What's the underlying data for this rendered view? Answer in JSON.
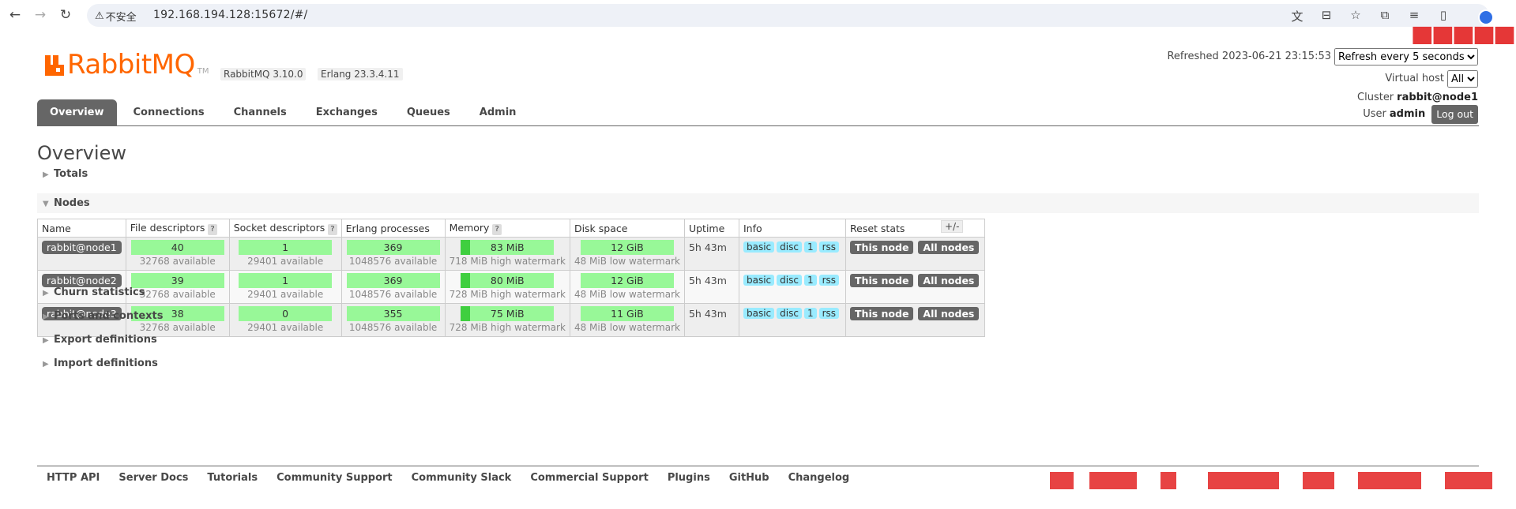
{
  "browser": {
    "security_label": "不安全",
    "url": "192.168.194.128:15672/#/"
  },
  "header": {
    "logo_text": "RabbitMQ",
    "logo_tm": "TM",
    "rabbitmq_version": "RabbitMQ 3.10.0",
    "erlang_version": "Erlang 23.3.4.11",
    "refreshed_label": "Refreshed 2023-06-21 23:15:53",
    "refresh_option": "Refresh every 5 seconds",
    "virtual_host_label": "Virtual host",
    "virtual_host_value": "All",
    "cluster_label": "Cluster",
    "cluster_value": "rabbit@node1",
    "user_label": "User",
    "user_value": "admin",
    "logout_label": "Log out"
  },
  "tabs": [
    {
      "label": "Overview"
    },
    {
      "label": "Connections"
    },
    {
      "label": "Channels"
    },
    {
      "label": "Exchanges"
    },
    {
      "label": "Queues"
    },
    {
      "label": "Admin"
    }
  ],
  "page_title": "Overview",
  "sections": {
    "totals": "Totals",
    "nodes": "Nodes",
    "churn": "Churn statistics",
    "ports": "Ports and contexts",
    "export": "Export definitions",
    "import": "Import definitions"
  },
  "table": {
    "headers": {
      "name": "Name",
      "fd": "File descriptors",
      "sd": "Socket descriptors",
      "ep": "Erlang processes",
      "mem": "Memory",
      "disk": "Disk space",
      "uptime": "Uptime",
      "info": "Info",
      "reset": "Reset stats",
      "help": "?",
      "plusminus": "+/-"
    },
    "info_tags": [
      "basic",
      "disc",
      "1",
      "rss"
    ],
    "btn_this": "This node",
    "btn_all": "All nodes",
    "rows": [
      {
        "name": "rabbit@node1",
        "fd": "40",
        "fd_avail": "32768 available",
        "sd": "1",
        "sd_avail": "29401 available",
        "ep": "369",
        "ep_avail": "1048576 available",
        "mem": "83 MiB",
        "mem_wm": "718 MiB high watermark",
        "disk": "12 GiB",
        "disk_wm": "48 MiB low watermark",
        "uptime": "5h 43m"
      },
      {
        "name": "rabbit@node2",
        "fd": "39",
        "fd_avail": "32768 available",
        "sd": "1",
        "sd_avail": "29401 available",
        "ep": "369",
        "ep_avail": "1048576 available",
        "mem": "80 MiB",
        "mem_wm": "728 MiB high watermark",
        "disk": "12 GiB",
        "disk_wm": "48 MiB low watermark",
        "uptime": "5h 43m"
      },
      {
        "name": "rabbit@node3",
        "fd": "38",
        "fd_avail": "32768 available",
        "sd": "0",
        "sd_avail": "29401 available",
        "ep": "355",
        "ep_avail": "1048576 available",
        "mem": "75 MiB",
        "mem_wm": "728 MiB high watermark",
        "disk": "11 GiB",
        "disk_wm": "48 MiB low watermark",
        "uptime": "5h 43m"
      }
    ]
  },
  "footer": [
    "HTTP API",
    "Server Docs",
    "Tutorials",
    "Community Support",
    "Community Slack",
    "Commercial Support",
    "Plugins",
    "GitHub",
    "Changelog"
  ],
  "colors": {
    "brand": "#ff6600",
    "tab_active": "#666666",
    "bar_green": "#98f898",
    "info_tag": "#99ebff"
  }
}
